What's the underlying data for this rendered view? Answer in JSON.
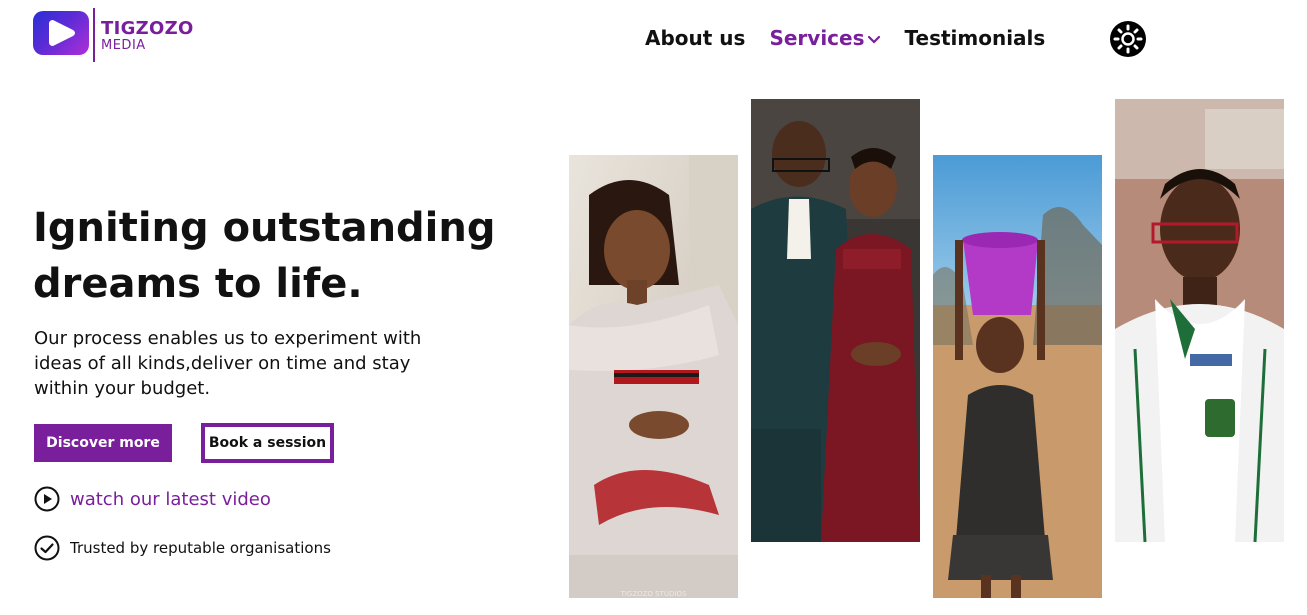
{
  "brand": {
    "name": "TIGZOZO",
    "sub": "MEDIA",
    "logo_icon": "play-icon",
    "color": "#7a1f9c"
  },
  "nav": {
    "about": "About us",
    "services": "Services",
    "testimonials": "Testimonials",
    "theme_icon": "sun-icon"
  },
  "hero": {
    "title_line1": "Igniting outstanding",
    "title_line2": "dreams to life.",
    "description": "Our process enables us to experiment with ideas of all kinds,deliver on time and stay within your budget.",
    "discover_label": "Discover more",
    "book_label": "Book a session",
    "video_label": "watch our latest video",
    "trusted_label": "Trusted by reputable organisations"
  },
  "gallery": {
    "watermark": "TIGZOZO STUDIOS"
  },
  "colors": {
    "accent": "#7a1f9c",
    "text": "#111111",
    "background": "#ffffff"
  }
}
